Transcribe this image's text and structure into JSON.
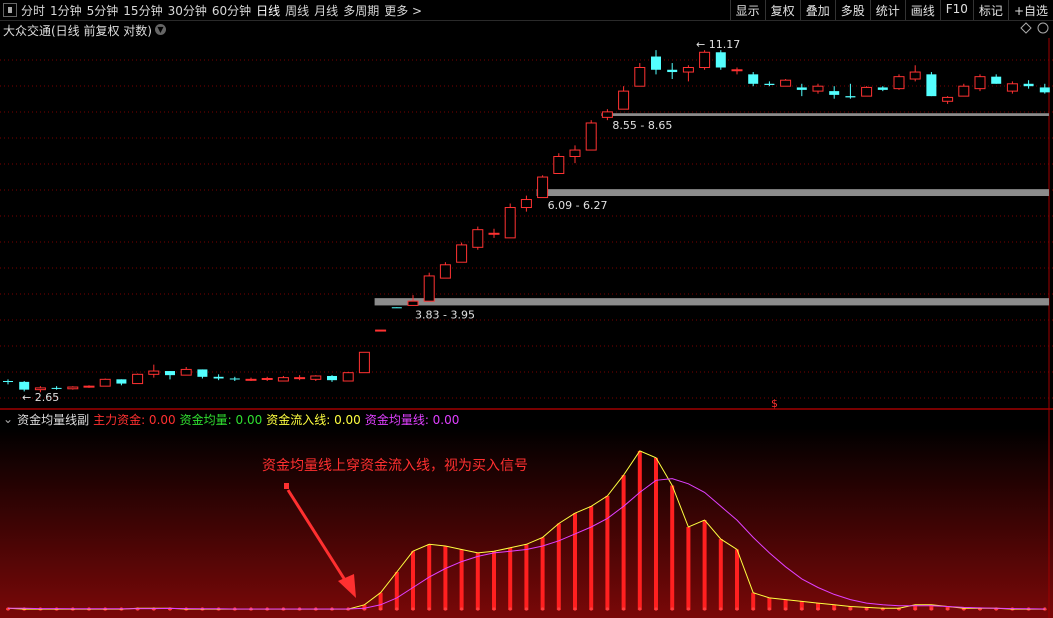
{
  "toolbar": {
    "periods": [
      "分时",
      "1分钟",
      "5分钟",
      "15分钟",
      "30分钟",
      "60分钟",
      "日线",
      "周线",
      "月线",
      "多周期",
      "更多 >"
    ],
    "active_period": "日线",
    "right_buttons": [
      "显示",
      "复权",
      "叠加",
      "多股",
      "统计",
      "画线",
      "F10",
      "标记",
      "+自选"
    ]
  },
  "main": {
    "title": "大众交通(日线 前复权 对数)",
    "labels": {
      "low": "2.65",
      "high": "11.17",
      "band1": "3.83 - 3.95",
      "band2": "6.09 - 6.27",
      "band3": "8.55 - 8.65",
      "marker": "$"
    }
  },
  "indicator": {
    "name": "资金均量线副",
    "items": [
      {
        "label": "主力资金:",
        "value": "0.00",
        "color": "#ff3030"
      },
      {
        "label": "资金均量:",
        "value": "0.00",
        "color": "#30e030"
      },
      {
        "label": "资金流入线:",
        "value": "0.00",
        "color": "#ffff40"
      },
      {
        "label": "资金均量线:",
        "value": "0.00",
        "color": "#e040ff"
      }
    ],
    "annotation": "资金均量线上穿资金流入线，视为买入信号"
  },
  "chart_data": {
    "type": "candlestick",
    "price_scale": "log",
    "candles": [
      [
        2.78,
        2.8,
        2.74,
        2.77
      ],
      [
        2.77,
        2.78,
        2.66,
        2.68
      ],
      [
        2.68,
        2.72,
        2.65,
        2.7
      ],
      [
        2.7,
        2.72,
        2.68,
        2.69
      ],
      [
        2.69,
        2.72,
        2.68,
        2.71
      ],
      [
        2.71,
        2.73,
        2.7,
        2.72
      ],
      [
        2.72,
        2.81,
        2.72,
        2.8
      ],
      [
        2.8,
        2.8,
        2.73,
        2.75
      ],
      [
        2.75,
        2.87,
        2.75,
        2.86
      ],
      [
        2.86,
        2.98,
        2.82,
        2.9
      ],
      [
        2.9,
        2.9,
        2.8,
        2.85
      ],
      [
        2.85,
        2.95,
        2.85,
        2.92
      ],
      [
        2.92,
        2.92,
        2.81,
        2.83
      ],
      [
        2.83,
        2.86,
        2.79,
        2.81
      ],
      [
        2.81,
        2.83,
        2.78,
        2.8
      ],
      [
        2.8,
        2.82,
        2.78,
        2.8
      ],
      [
        2.8,
        2.83,
        2.78,
        2.81
      ],
      [
        2.78,
        2.84,
        2.78,
        2.82
      ],
      [
        2.81,
        2.85,
        2.79,
        2.82
      ],
      [
        2.8,
        2.85,
        2.78,
        2.84
      ],
      [
        2.84,
        2.85,
        2.77,
        2.79
      ],
      [
        2.78,
        2.89,
        2.78,
        2.88
      ],
      [
        2.88,
        3.14,
        2.88,
        3.14
      ],
      [
        3.45,
        3.45,
        3.45,
        3.45
      ],
      [
        3.8,
        3.8,
        3.79,
        3.79
      ],
      [
        3.83,
        4.0,
        3.83,
        3.9
      ],
      [
        3.9,
        4.4,
        3.9,
        4.34
      ],
      [
        4.3,
        4.6,
        4.3,
        4.55
      ],
      [
        4.6,
        5.0,
        4.6,
        4.95
      ],
      [
        4.9,
        5.35,
        4.85,
        5.28
      ],
      [
        5.2,
        5.3,
        5.1,
        5.2
      ],
      [
        5.1,
        5.9,
        5.1,
        5.8
      ],
      [
        5.8,
        6.1,
        5.7,
        6.0
      ],
      [
        6.05,
        6.65,
        6.05,
        6.6
      ],
      [
        6.7,
        7.3,
        6.7,
        7.2
      ],
      [
        7.2,
        7.55,
        7.0,
        7.4
      ],
      [
        7.4,
        8.4,
        7.4,
        8.3
      ],
      [
        8.5,
        8.8,
        8.4,
        8.7
      ],
      [
        8.8,
        9.7,
        8.8,
        9.5
      ],
      [
        9.7,
        10.7,
        9.7,
        10.5
      ],
      [
        11.0,
        11.3,
        10.2,
        10.4
      ],
      [
        10.4,
        10.7,
        10.0,
        10.3
      ],
      [
        10.3,
        10.6,
        9.9,
        10.5
      ],
      [
        10.5,
        11.3,
        10.4,
        11.2
      ],
      [
        11.2,
        11.3,
        10.4,
        10.5
      ],
      [
        10.4,
        10.5,
        10.2,
        10.4
      ],
      [
        10.2,
        10.3,
        9.7,
        9.8
      ],
      [
        9.8,
        9.9,
        9.7,
        9.75
      ],
      [
        9.7,
        10.0,
        9.7,
        9.95
      ],
      [
        9.65,
        9.8,
        9.3,
        9.55
      ],
      [
        9.5,
        9.8,
        9.4,
        9.7
      ],
      [
        9.5,
        9.7,
        9.2,
        9.35
      ],
      [
        9.3,
        9.8,
        9.2,
        9.25
      ],
      [
        9.3,
        9.7,
        9.3,
        9.65
      ],
      [
        9.65,
        9.7,
        9.5,
        9.55
      ],
      [
        9.6,
        10.2,
        9.55,
        10.1
      ],
      [
        10.0,
        10.6,
        9.9,
        10.3
      ],
      [
        10.2,
        10.3,
        9.3,
        9.3
      ],
      [
        9.1,
        9.3,
        9.0,
        9.25
      ],
      [
        9.3,
        9.8,
        9.3,
        9.7
      ],
      [
        9.6,
        10.2,
        9.5,
        10.1
      ],
      [
        10.1,
        10.2,
        9.8,
        9.8
      ],
      [
        9.5,
        9.9,
        9.4,
        9.8
      ],
      [
        9.8,
        9.95,
        9.6,
        9.7
      ],
      [
        9.65,
        9.8,
        9.4,
        9.45
      ]
    ],
    "bands": [
      [
        3.83,
        3.95
      ],
      [
        6.09,
        6.27
      ],
      [
        8.55,
        8.65
      ]
    ],
    "indicator_bars": [
      0.01,
      0.005,
      0.005,
      0.005,
      0.005,
      0.005,
      0.005,
      0.005,
      0.01,
      0.01,
      0.01,
      0.005,
      0.005,
      0.005,
      0.005,
      0.005,
      0.005,
      0.005,
      0.005,
      0.005,
      0.005,
      0.005,
      0.03,
      0.1,
      0.22,
      0.34,
      0.38,
      0.37,
      0.35,
      0.33,
      0.34,
      0.36,
      0.38,
      0.42,
      0.5,
      0.56,
      0.6,
      0.66,
      0.78,
      0.92,
      0.88,
      0.72,
      0.48,
      0.52,
      0.41,
      0.35,
      0.1,
      0.07,
      0.06,
      0.05,
      0.04,
      0.03,
      0.02,
      0.015,
      0.01,
      0.01,
      0.03,
      0.03,
      0.02,
      0.01,
      0.01,
      0.01,
      0.005,
      0.005,
      0.005
    ],
    "line_inflow": [
      0.01,
      0.005,
      0.005,
      0.005,
      0.005,
      0.005,
      0.005,
      0.005,
      0.01,
      0.01,
      0.01,
      0.005,
      0.005,
      0.005,
      0.005,
      0.005,
      0.005,
      0.005,
      0.005,
      0.005,
      0.005,
      0.005,
      0.03,
      0.1,
      0.22,
      0.34,
      0.38,
      0.37,
      0.35,
      0.33,
      0.34,
      0.36,
      0.38,
      0.42,
      0.5,
      0.56,
      0.6,
      0.66,
      0.78,
      0.92,
      0.88,
      0.72,
      0.48,
      0.52,
      0.41,
      0.35,
      0.1,
      0.07,
      0.06,
      0.05,
      0.04,
      0.03,
      0.02,
      0.015,
      0.01,
      0.01,
      0.03,
      0.03,
      0.02,
      0.01,
      0.01,
      0.01,
      0.005,
      0.005,
      0.005
    ],
    "line_avg": [
      0.01,
      0.01,
      0.008,
      0.008,
      0.007,
      0.007,
      0.007,
      0.007,
      0.008,
      0.008,
      0.009,
      0.008,
      0.007,
      0.007,
      0.006,
      0.006,
      0.006,
      0.006,
      0.006,
      0.006,
      0.006,
      0.006,
      0.01,
      0.03,
      0.07,
      0.13,
      0.19,
      0.24,
      0.28,
      0.31,
      0.33,
      0.34,
      0.35,
      0.37,
      0.4,
      0.44,
      0.48,
      0.53,
      0.6,
      0.68,
      0.75,
      0.76,
      0.73,
      0.68,
      0.6,
      0.52,
      0.42,
      0.33,
      0.25,
      0.18,
      0.13,
      0.09,
      0.06,
      0.04,
      0.03,
      0.025,
      0.025,
      0.025,
      0.02,
      0.015,
      0.012,
      0.01,
      0.008,
      0.007,
      0.006
    ]
  },
  "colors": {
    "up": "#ff3232",
    "down": "#54ffff",
    "band": "#8c8c8c",
    "inflow_line": "#ffff40",
    "avg_line": "#e040ff",
    "grid": "#7a0000"
  }
}
